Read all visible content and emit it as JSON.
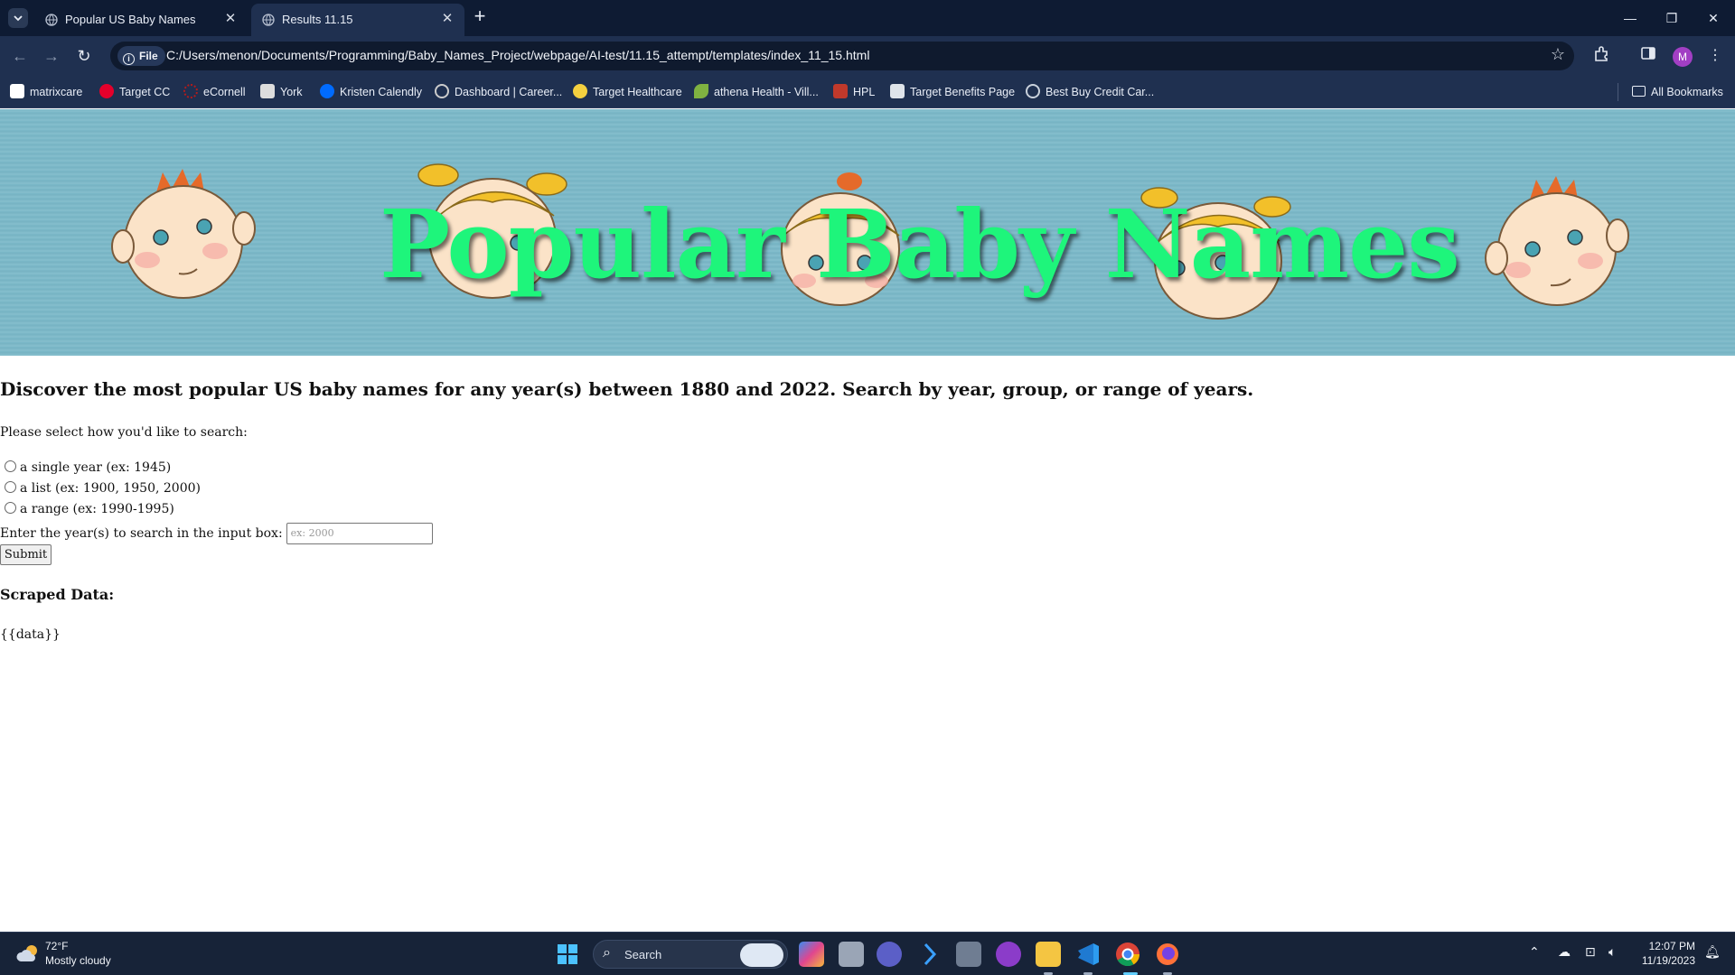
{
  "browser": {
    "tabs": [
      {
        "title": "Popular US Baby Names",
        "active": false,
        "icon": "globe-icon"
      },
      {
        "title": "Results 11.15",
        "active": true,
        "icon": "globe-icon"
      }
    ],
    "omnibox": {
      "security_label": "File",
      "url": "C:/Users/menon/Documents/Programming/Baby_Names_Project/webpage/AI-test/11.15_attempt/templates/index_11_15.html"
    },
    "profile_initial": "M",
    "bookmarks": [
      {
        "label": "matrixcare",
        "icon_color": "#ffffff"
      },
      {
        "label": "Target CC",
        "icon_color": "#e4002b"
      },
      {
        "label": "eCornell",
        "icon_color": "#b31b1b"
      },
      {
        "label": "York",
        "icon_color": "#dddddd"
      },
      {
        "label": "Kristen Calendly",
        "icon_color": "#006bff"
      },
      {
        "label": "Dashboard | Career...",
        "icon_color": "#222222"
      },
      {
        "label": "Target Healthcare",
        "icon_color": "#f4d03f"
      },
      {
        "label": "athena Health - Vill...",
        "icon_color": "#7fb241"
      },
      {
        "label": "HPL",
        "icon_color": "#c0392b"
      },
      {
        "label": "Target Benefits Page",
        "icon_color": "#dfe4ea"
      },
      {
        "label": "Best Buy Credit Car...",
        "icon_color": "#c9d1dc"
      }
    ],
    "all_bookmarks_label": "All Bookmarks"
  },
  "page": {
    "banner_title": "Popular Baby Names",
    "intro": "Discover the most popular US baby names for any year(s) between 1880 and 2022. Search by year, group, or range of years.",
    "prompt": "Please select how you'd like to search:",
    "options": [
      {
        "label": "a single year (ex: 1945)",
        "selected": false
      },
      {
        "label": "a list (ex: 1900, 1950, 2000)",
        "selected": false
      },
      {
        "label": "a range (ex: 1990-1995)",
        "selected": false
      }
    ],
    "year_input_label": "Enter the year(s) to search in the input box:",
    "year_input_placeholder": "ex: 2000",
    "submit_label": "Submit",
    "scraped_heading": "Scraped Data:",
    "scraped_content": "{{data}}"
  },
  "taskbar": {
    "weather_temp": "72°F",
    "weather_desc": "Mostly cloudy",
    "search_placeholder": "Search",
    "clock_time": "12:07 PM",
    "clock_date": "11/19/2023"
  },
  "colors": {
    "title_green": "#1ef57b",
    "banner_blue": "#7ab8c8",
    "chrome_dark": "#0e1b33",
    "chrome_toolbar": "#1f3050"
  }
}
